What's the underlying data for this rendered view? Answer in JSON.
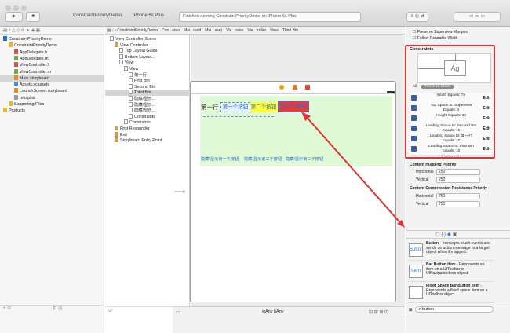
{
  "toolbar": {
    "scheme": "ConstraintPriorityDemo",
    "device": "iPhone 6s Plus",
    "status": "Finished running ConstraintPriorityDemo on iPhone 6s Plus"
  },
  "navigator": {
    "items": [
      {
        "label": "ConstraintPriorityDemo",
        "indent": 0,
        "kind": "project",
        "selected": false
      },
      {
        "label": "ConstraintPriorityDemo",
        "indent": 1,
        "kind": "folder",
        "selected": false
      },
      {
        "label": "AppDelegate.h",
        "indent": 2,
        "kind": "h",
        "selected": false
      },
      {
        "label": "AppDelegate.m",
        "indent": 2,
        "kind": "m",
        "selected": false
      },
      {
        "label": "ViewController.h",
        "indent": 2,
        "kind": "h",
        "selected": false
      },
      {
        "label": "ViewController.m",
        "indent": 2,
        "kind": "m",
        "selected": false
      },
      {
        "label": "Main.storyboard",
        "indent": 2,
        "kind": "sb",
        "selected": true
      },
      {
        "label": "Assets.xcassets",
        "indent": 2,
        "kind": "asset",
        "selected": false
      },
      {
        "label": "LaunchScreen.storyboard",
        "indent": 2,
        "kind": "sb",
        "selected": false
      },
      {
        "label": "Info.plist",
        "indent": 2,
        "kind": "plist",
        "selected": false
      },
      {
        "label": "Supporting Files",
        "indent": 1,
        "kind": "folder",
        "selected": false
      },
      {
        "label": "Products",
        "indent": 0,
        "kind": "folder",
        "selected": false
      }
    ]
  },
  "jumpbar": [
    "ConstraintPriorityDemo",
    "Con...emo",
    "Mai...oard",
    "Mai...ase)",
    "Vie...cene",
    "Vie...troller",
    "View",
    "Third Btn"
  ],
  "outline": {
    "items": [
      {
        "label": "View Controller Scene",
        "indent": 0,
        "selected": false
      },
      {
        "label": "View Controller",
        "indent": 1,
        "selected": false
      },
      {
        "label": "Top Layout Guide",
        "indent": 2,
        "selected": false
      },
      {
        "label": "Bottom Layout...",
        "indent": 2,
        "selected": false
      },
      {
        "label": "View",
        "indent": 2,
        "selected": false
      },
      {
        "label": "View",
        "indent": 3,
        "selected": false
      },
      {
        "label": "第一行",
        "indent": 4,
        "selected": false
      },
      {
        "label": "First Btn",
        "indent": 4,
        "selected": false
      },
      {
        "label": "Second Btn",
        "indent": 4,
        "selected": false
      },
      {
        "label": "Third Btn",
        "indent": 4,
        "selected": true
      },
      {
        "label": "隐藏/显示...",
        "indent": 4,
        "selected": false
      },
      {
        "label": "隐藏/显示...",
        "indent": 4,
        "selected": false
      },
      {
        "label": "隐藏/显示...",
        "indent": 4,
        "selected": false
      },
      {
        "label": "Constraints",
        "indent": 4,
        "selected": false
      },
      {
        "label": "Constraints",
        "indent": 3,
        "selected": false
      },
      {
        "label": "First Responder",
        "indent": 1,
        "selected": false
      },
      {
        "label": "Exit",
        "indent": 1,
        "selected": false
      },
      {
        "label": "Storyboard Entry Point",
        "indent": 1,
        "selected": false
      }
    ]
  },
  "canvas": {
    "row_label": "第一行",
    "btn1": "第一个按钮",
    "btn2": "第二个按钮",
    "btn3": "第三个按钮",
    "toggles": [
      "隐藏/显示第一个按钮",
      "隐藏/显示第二个按钮",
      "隐藏/显示第三个按钮"
    ],
    "size_class": "wAny hAny"
  },
  "inspector": {
    "top_options": [
      "Preserve Superview Margins",
      "Follow Readable Width"
    ],
    "constraints_title": "Constraints",
    "preview_label": "Ag",
    "filter_tabs": [
      "All",
      "This Size Class"
    ],
    "constraints": [
      {
        "text": "Width Equals:  75",
        "edit": "Edit"
      },
      {
        "text": "Top Space to: Superview\nEquals:  4",
        "edit": "Edit"
      },
      {
        "text": "Height Equals:  30",
        "edit": "Edit"
      },
      {
        "text": "Leading Space to: Second Btn\nEquals:  15",
        "edit": "Edit"
      },
      {
        "text": "Leading Space to: 第一行\nEquals:  10",
        "edit": "Edit"
      },
      {
        "text": "Leading Space to: First Btn\nEquals:  10",
        "edit": "Edit"
      }
    ],
    "showing": "Showing 6 of 6",
    "hugging_title": "Content Hugging Priority",
    "hugging": [
      {
        "label": "Horizontal",
        "value": "250"
      },
      {
        "label": "Vertical",
        "value": "250"
      }
    ],
    "compression_title": "Content Compression Resistance Priority",
    "compression": [
      {
        "label": "Horizontal",
        "value": "750"
      },
      {
        "label": "Vertical",
        "value": "750"
      }
    ],
    "library": [
      {
        "icon": "Button",
        "title": "Button",
        "desc": "- Intercepts touch events and sends an action message to a target object when it's tapped."
      },
      {
        "icon": "Item",
        "title": "Bar Button Item",
        "desc": "- Represents an item on a UIToolbar or UINavigationItem object."
      },
      {
        "icon": "",
        "title": "Fixed Space Bar Button Item",
        "desc": "- Represents a fixed space item on a UIToolbar object."
      }
    ],
    "search_value": "button"
  },
  "colors": {
    "accent": "#2a6ed3",
    "highlight": "#d33",
    "green": "#dff8d5",
    "yellow": "#ffff33",
    "selected_btn": "#e53b3b"
  }
}
